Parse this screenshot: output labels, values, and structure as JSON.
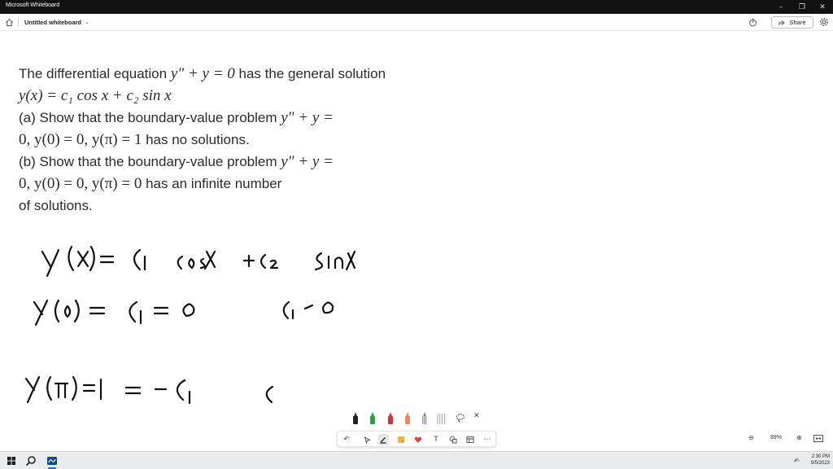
{
  "window": {
    "app_title": "Microsoft Whiteboard"
  },
  "header": {
    "doc_title": "Untitled whiteboard",
    "share_label": "Share"
  },
  "problem": {
    "intro_text": "The differential equation",
    "intro_math": "y″ + y = 0",
    "intro_tail": "has the general solution",
    "solution_math": "y(x) = c₁ cos x + c₂ sin x",
    "a_text": "(a) Show that the boundary-value problem",
    "a_math1": "y″ + y =",
    "a_math2": "0,    y(0) = 0,    y(π) = 1",
    "a_tail": "has no solutions.",
    "b_text": "(b) Show that the boundary-value problem",
    "b_math1": "y″ + y =",
    "b_math2": "0,    y(0) = 0,    y(π) = 0",
    "b_tail": "has an infinite number",
    "b_tail2": "of solutions."
  },
  "handwriting": [
    "y(x) = c₁ cos x + c₂ sin x",
    "y(0) = c₁ = 0     c₁ = 0",
    "y(π) = 1 = −c₁     c"
  ],
  "zoom": {
    "level": "89%"
  },
  "taskbar": {
    "time": "2:30 PM",
    "date": "9/5/2023"
  },
  "colors": {
    "accent": "#2564cf",
    "pen_black": "#222222",
    "pen_green": "#2e9b4a",
    "pen_red": "#d13438",
    "pen_orange": "#e88a5a",
    "heart": "#e0443e",
    "sticky": "#f3b33d"
  }
}
